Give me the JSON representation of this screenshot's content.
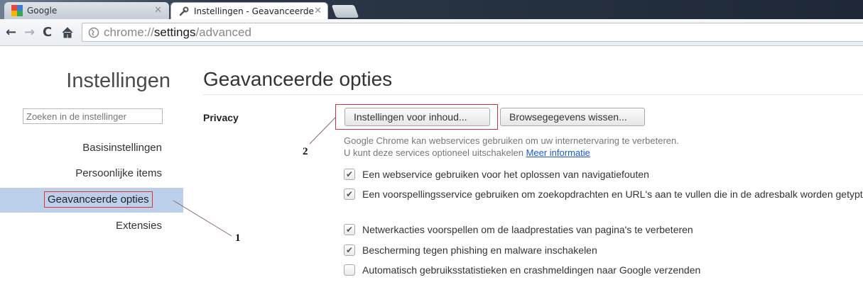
{
  "tabs": [
    {
      "title": "Google",
      "icon": "google-favicon-icon",
      "active": false
    },
    {
      "title": "Instellingen - Geavanceerde",
      "icon": "wrench-icon",
      "active": true
    }
  ],
  "toolbar": {
    "url_scheme": "chrome://",
    "url_host": "settings",
    "url_path": "/advanced"
  },
  "sidebar": {
    "title": "Instellingen",
    "search_placeholder": "Zoeken in de instellinger",
    "items": [
      {
        "label": "Basisinstellingen",
        "selected": false
      },
      {
        "label": "Persoonlijke items",
        "selected": false
      },
      {
        "label": "Geavanceerde opties",
        "selected": true
      },
      {
        "label": "Extensies",
        "selected": false
      }
    ]
  },
  "main": {
    "title": "Geavanceerde opties",
    "privacy": {
      "label": "Privacy",
      "content_settings_button": "Instellingen voor inhoud...",
      "clear_browsing_button": "Browsegegevens wissen...",
      "description_line1": "Google Chrome kan webservices gebruiken om uw internetervaring te verbeteren.",
      "description_line2": "U kunt deze services optioneel uitschakelen",
      "more_info_link": "Meer informatie",
      "options": [
        {
          "label": "Een webservice gebruiken voor het oplossen van navigatiefouten",
          "checked": true
        },
        {
          "label": "Een voorspellingsservice gebruiken om zoekopdrachten en URL's aan te vullen die in de adresbalk worden getypt",
          "checked": true
        },
        {
          "label": "Netwerkacties voorspellen om de laadprestaties van pagina's te verbeteren",
          "checked": true
        },
        {
          "label": "Bescherming tegen phishing en malware inschakelen",
          "checked": true
        },
        {
          "label": "Automatisch gebruiksstatistieken en crashmeldingen naar Google verzenden",
          "checked": false
        }
      ]
    }
  },
  "annotations": {
    "marker1": "1",
    "marker2": "2",
    "highlight_color": "#cc3333"
  },
  "colors": {
    "sidebar_selected_bg": "#bcd0ec",
    "link": "#1a5cc7"
  }
}
